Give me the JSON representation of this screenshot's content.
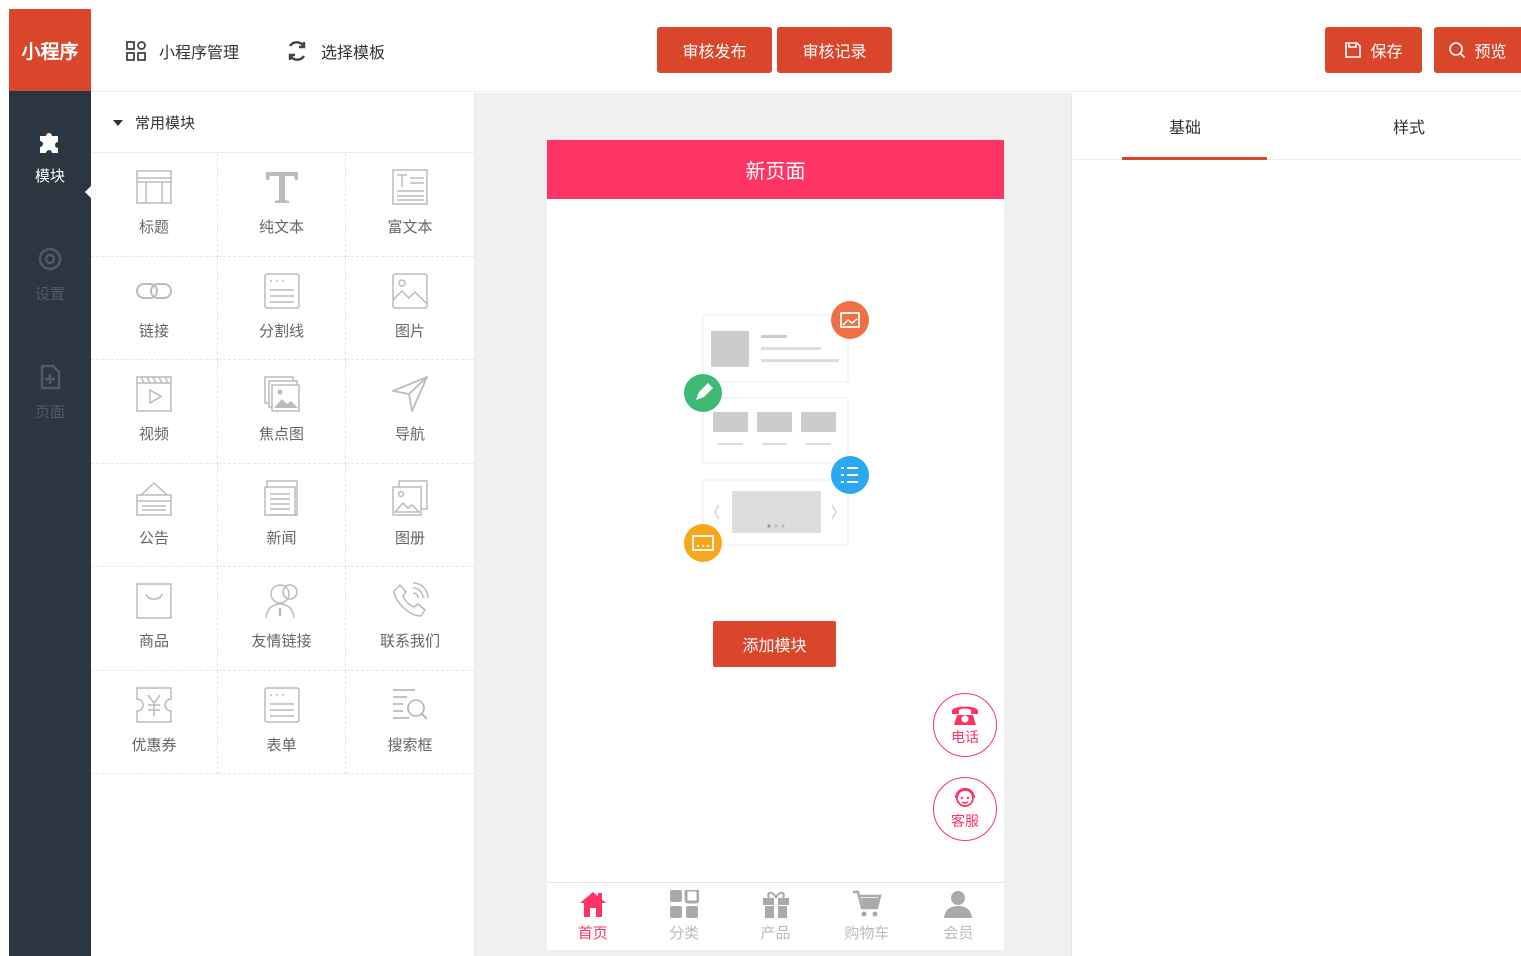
{
  "app": {
    "logo": "小程序"
  },
  "sidebar": {
    "items": [
      {
        "label": "模块",
        "icon": "puzzle-icon",
        "active": true
      },
      {
        "label": "设置",
        "icon": "settings-icon",
        "active": false
      },
      {
        "label": "页面",
        "icon": "page-icon",
        "active": false
      }
    ]
  },
  "topbar": {
    "manage_label": "小程序管理",
    "template_label": "选择模板",
    "publish_label": "审核发布",
    "records_label": "审核记录",
    "save_label": "保存",
    "preview_label": "预览"
  },
  "modules": {
    "group_title": "常用模块",
    "items": [
      {
        "label": "标题",
        "icon": "title-icon"
      },
      {
        "label": "纯文本",
        "icon": "plain-text-icon"
      },
      {
        "label": "富文本",
        "icon": "rich-text-icon"
      },
      {
        "label": "链接",
        "icon": "link-icon"
      },
      {
        "label": "分割线",
        "icon": "divider-icon"
      },
      {
        "label": "图片",
        "icon": "image-icon"
      },
      {
        "label": "视频",
        "icon": "video-icon"
      },
      {
        "label": "焦点图",
        "icon": "carousel-icon"
      },
      {
        "label": "导航",
        "icon": "navigation-icon"
      },
      {
        "label": "公告",
        "icon": "notice-icon"
      },
      {
        "label": "新闻",
        "icon": "news-icon"
      },
      {
        "label": "图册",
        "icon": "album-icon"
      },
      {
        "label": "商品",
        "icon": "goods-icon"
      },
      {
        "label": "友情链接",
        "icon": "friend-link-icon"
      },
      {
        "label": "联系我们",
        "icon": "contact-icon"
      },
      {
        "label": "优惠券",
        "icon": "coupon-icon"
      },
      {
        "label": "表单",
        "icon": "form-icon"
      },
      {
        "label": "搜索框",
        "icon": "search-box-icon"
      }
    ]
  },
  "phone": {
    "title": "新页面",
    "add_button": "添加模块",
    "float_phone": "电话",
    "float_service": "客服",
    "tabs": [
      {
        "label": "首页",
        "icon": "home-icon",
        "active": true
      },
      {
        "label": "分类",
        "icon": "category-icon",
        "active": false
      },
      {
        "label": "产品",
        "icon": "product-icon",
        "active": false
      },
      {
        "label": "购物车",
        "icon": "cart-icon",
        "active": false
      },
      {
        "label": "会员",
        "icon": "member-icon",
        "active": false
      }
    ]
  },
  "props": {
    "tabs": [
      "基础",
      "样式"
    ],
    "active_tab": "基础"
  },
  "colors": {
    "brand": "#d9462c",
    "phone_header": "#fe3464",
    "sidebar_bg": "#2b3640"
  }
}
